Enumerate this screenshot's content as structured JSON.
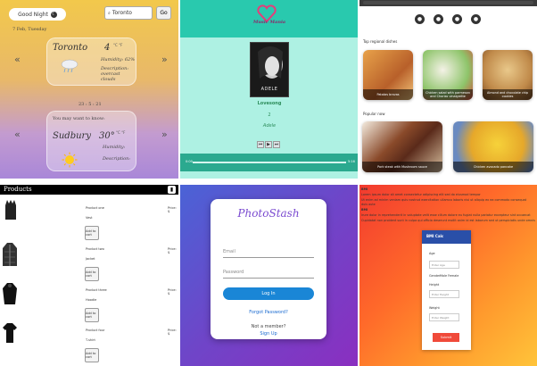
{
  "weather": {
    "greeting": "Good Night",
    "search_value": "Toronto",
    "go_label": "Go",
    "date": "7 Feb, Tuesday",
    "city1": "Toronto",
    "temp1": "4",
    "unit_labels": "°C °F",
    "humidity1": "Humidity: 62%",
    "description1": "Description: overcast clouds",
    "time": "23 : 5 : 21",
    "prompt": "You may want to know:",
    "city2": "Sudbury",
    "temp2": "30°",
    "humidity2": "Humidity:",
    "description2": "Description:"
  },
  "music": {
    "logo_text": "Music Mania",
    "song_title": "Lovesong",
    "track_no": "2",
    "artist": "Adele",
    "album_text": "ADELE",
    "time_start": "0:00",
    "time_end": "5:16"
  },
  "food": {
    "section1": "Top regional dishes",
    "section2": "Popular now",
    "cards": [
      {
        "caption": "Patatas bravas"
      },
      {
        "caption": "Chicken salad with parmesan and Chorizo vinaigrette"
      },
      {
        "caption": "Almond and chocolate chip cookies"
      },
      {
        "caption": "Pork steak with Mushroom sauce"
      },
      {
        "caption": "Chicken avocado pancake"
      }
    ]
  },
  "products": {
    "title": "Products",
    "items": [
      {
        "name": "Product one",
        "price": "Price: $",
        "sub": "Vest",
        "button": "Add to cart"
      },
      {
        "name": "Product two",
        "price": "Price: $",
        "sub": "Jacket",
        "button": "Add to cart"
      },
      {
        "name": "Product three",
        "price": "Price: $",
        "sub": "Hoodie",
        "button": "Add to cart"
      },
      {
        "name": "Product four",
        "price": "Price: $",
        "sub": "T-shirt",
        "button": "Add to cart"
      }
    ]
  },
  "photostash": {
    "logo": "PhotoStash",
    "email_placeholder": "Email",
    "password_placeholder": "Password",
    "login_label": "Log In",
    "forgot": "Forgot Password?",
    "not_member": "Not a member?",
    "signup": "Sign Up"
  },
  "form": {
    "heading1": "BMI",
    "para1": "Lorem ipsum dolor sit amet consectetur adipiscing elit sed do eiusmod tempor",
    "para2": "Ut enim ad minim veniam quis nostrud exercitation ullamco laboris nisi ut aliquip ex ea commodo consequat duis aute",
    "heading2": "BMI",
    "para3": "Irure dolor in reprehenderit in voluptate velit esse cillum dolore eu fugiat nulla pariatur excepteur sint occaecat",
    "para4": "Cupidatat non proident sunt in culpa qui officia deserunt mollit anim id est laborum sed ut perspiciatis unde omnis",
    "card_title": "BMI Calc",
    "age_label": "Age",
    "age_placeholder": "Enter Age",
    "gender_label": "Gender",
    "gender_opts": "Male   Female",
    "height_label": "Height",
    "height_placeholder": "Enter Height",
    "weight_label": "Weight",
    "weight_placeholder": "Enter Weight",
    "submit": "Submit"
  },
  "colors": {
    "weather_top": "#f2c84b",
    "weather_bottom": "#a987d8",
    "music_bg": "#aef1e3",
    "music_accent": "#29b8a0",
    "photostash_purple": "#6f45c8",
    "login_blue": "#1a86d6",
    "form_orange": "#ff6a2a",
    "form_blue": "#2a4fa8"
  }
}
